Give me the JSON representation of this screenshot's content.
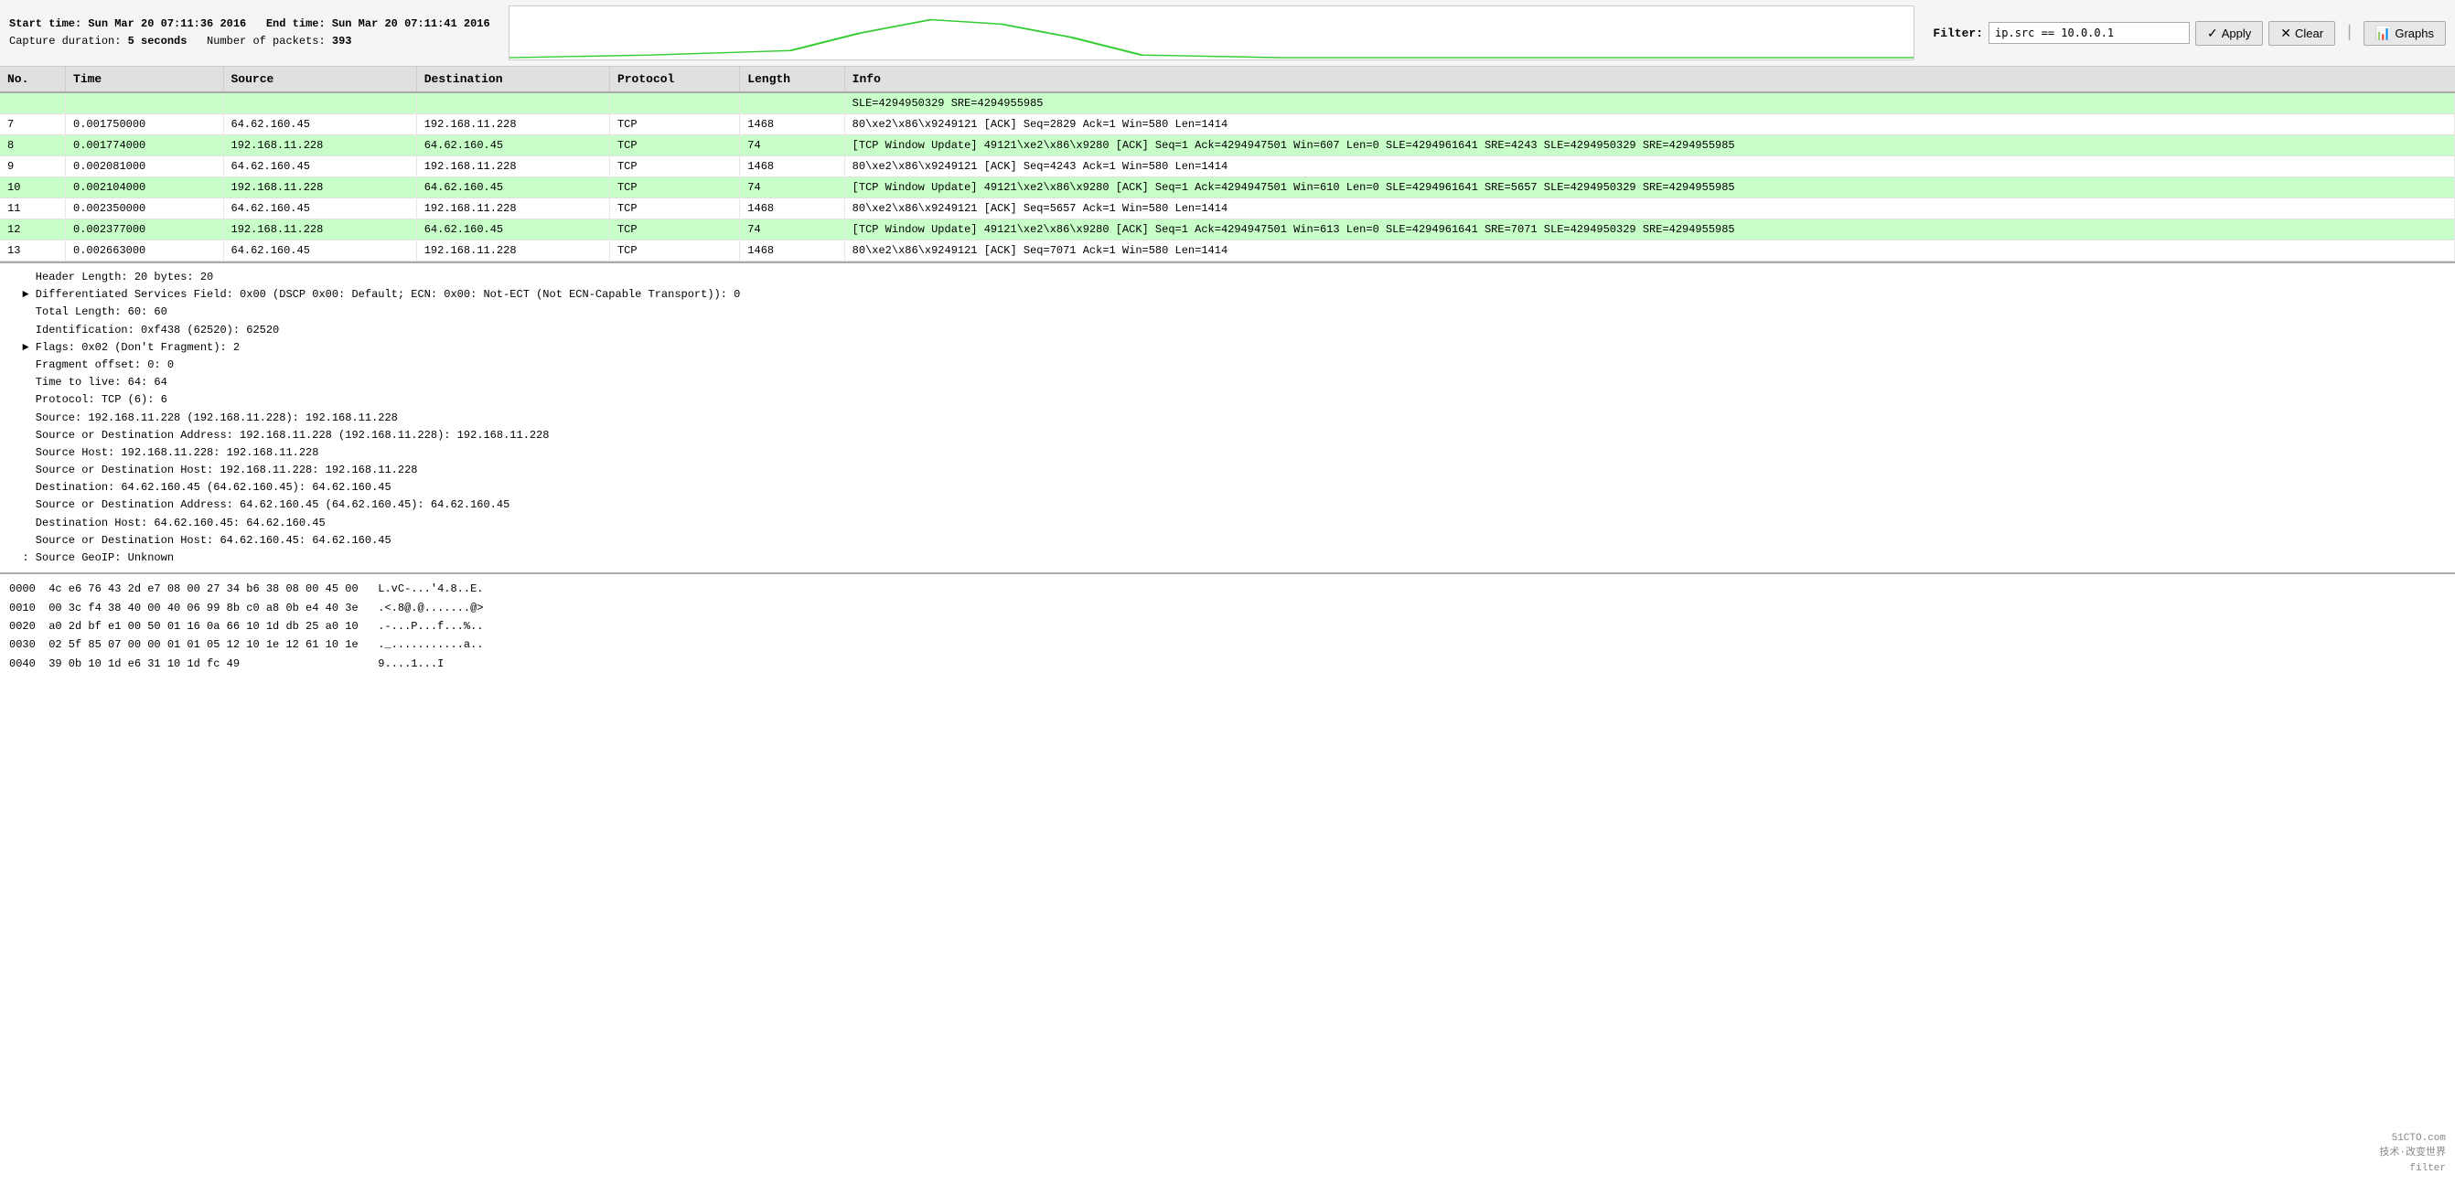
{
  "header": {
    "start_label": "Start time:",
    "start_value": "Sun Mar 20 07:11:36 2016",
    "end_label": "End time:",
    "end_value": "Sun Mar 20 07:11:41 2016",
    "capture_label": "Capture duration:",
    "capture_value": "5 seconds",
    "packets_label": "Number of packets:",
    "packets_value": "393",
    "filter_label": "Filter:",
    "filter_value": "ip.src == 10.0.0.1",
    "apply_label": "Apply",
    "clear_label": "Clear",
    "graphs_label": "Graphs"
  },
  "table": {
    "columns": [
      "No.",
      "Time",
      "Source",
      "Destination",
      "Protocol",
      "Length",
      "Info"
    ],
    "rows": [
      {
        "no": "",
        "time": "",
        "source": "",
        "destination": "",
        "protocol": "",
        "length": "",
        "info": "SLE=4294950329 SRE=4294955985",
        "class": "highlight-green"
      },
      {
        "no": "7",
        "time": "0.001750000",
        "source": "64.62.160.45",
        "destination": "192.168.11.228",
        "protocol": "TCP",
        "length": "1468",
        "info": "80\\xe2\\x86\\x9249121 [ACK] Seq=2829 Ack=1 Win=580 Len=1414",
        "class": ""
      },
      {
        "no": "8",
        "time": "0.001774000",
        "source": "192.168.11.228",
        "destination": "64.62.160.45",
        "protocol": "TCP",
        "length": "74",
        "info": "[TCP Window Update] 49121\\xe2\\x86\\x9280 [ACK] Seq=1 Ack=4294947501 Win=607 Len=0 SLE=4294961641 SRE=4243 SLE=4294950329 SRE=4294955985",
        "class": "highlight-green"
      },
      {
        "no": "9",
        "time": "0.002081000",
        "source": "64.62.160.45",
        "destination": "192.168.11.228",
        "protocol": "TCP",
        "length": "1468",
        "info": "80\\xe2\\x86\\x9249121 [ACK] Seq=4243 Ack=1 Win=580 Len=1414",
        "class": ""
      },
      {
        "no": "10",
        "time": "0.002104000",
        "source": "192.168.11.228",
        "destination": "64.62.160.45",
        "protocol": "TCP",
        "length": "74",
        "info": "[TCP Window Update] 49121\\xe2\\x86\\x9280 [ACK] Seq=1 Ack=4294947501 Win=610 Len=0 SLE=4294961641 SRE=5657 SLE=4294950329 SRE=4294955985",
        "class": "highlight-green"
      },
      {
        "no": "11",
        "time": "0.002350000",
        "source": "64.62.160.45",
        "destination": "192.168.11.228",
        "protocol": "TCP",
        "length": "1468",
        "info": "80\\xe2\\x86\\x9249121 [ACK] Seq=5657 Ack=1 Win=580 Len=1414",
        "class": ""
      },
      {
        "no": "12",
        "time": "0.002377000",
        "source": "192.168.11.228",
        "destination": "64.62.160.45",
        "protocol": "TCP",
        "length": "74",
        "info": "[TCP Window Update] 49121\\xe2\\x86\\x9280 [ACK] Seq=1 Ack=4294947501 Win=613 Len=0 SLE=4294961641 SRE=7071 SLE=4294950329 SRE=4294955985",
        "class": "highlight-green"
      },
      {
        "no": "13",
        "time": "0.002663000",
        "source": "64.62.160.45",
        "destination": "192.168.11.228",
        "protocol": "TCP",
        "length": "1468",
        "info": "80\\xe2\\x86\\x9249121 [ACK] Seq=7071 Ack=1 Win=580 Len=1414",
        "class": ""
      }
    ]
  },
  "detail": {
    "lines": [
      "    Header Length: 20 bytes: 20",
      "  ► Differentiated Services Field: 0x00 (DSCP 0x00: Default; ECN: 0x00: Not-ECT (Not ECN-Capable Transport)): 0",
      "    Total Length: 60: 60",
      "    Identification: 0xf438 (62520): 62520",
      "  ► Flags: 0x02 (Don't Fragment): 2",
      "    Fragment offset: 0: 0",
      "    Time to live: 64: 64",
      "    Protocol: TCP (6): 6",
      "    Source: 192.168.11.228 (192.168.11.228): 192.168.11.228",
      "    Source or Destination Address: 192.168.11.228 (192.168.11.228): 192.168.11.228",
      "    Source Host: 192.168.11.228: 192.168.11.228",
      "    Source or Destination Host: 192.168.11.228: 192.168.11.228",
      "    Destination: 64.62.160.45 (64.62.160.45): 64.62.160.45",
      "    Source or Destination Address: 64.62.160.45 (64.62.160.45): 64.62.160.45",
      "    Destination Host: 64.62.160.45: 64.62.160.45",
      "    Source or Destination Host: 64.62.160.45: 64.62.160.45",
      "  : Source GeoIP: Unknown"
    ]
  },
  "hex": {
    "lines": [
      "0000  4c e6 76 43 2d e7 08 00 27 34 b6 38 08 00 45 00   L.vC-...'4.8..E.",
      "0010  00 3c f4 38 40 00 40 06 99 8b c0 a8 0b e4 40 3e   .<.8@.@.......@>",
      "0020  a0 2d bf e1 00 50 01 16 0a 66 10 1d db 25 a0 10   .-...P...f...%..",
      "0030  02 5f 85 07 00 00 01 01 05 12 10 1e 12 61 10 1e   ._...........a..",
      "0040  39 0b 10 1d e6 31 10 1d fc 49                     9....1...I"
    ]
  },
  "watermark": {
    "line1": "51CTO.com",
    "line2": "技术·改变世界",
    "line3": "filter"
  }
}
